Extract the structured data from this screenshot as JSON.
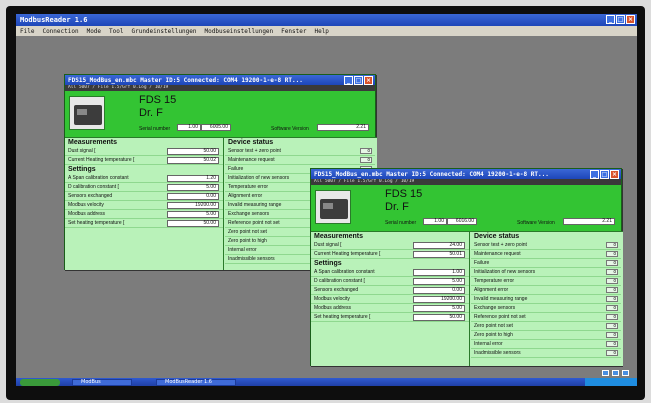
{
  "app": {
    "title": "ModbusReader 1.6",
    "menu": [
      "File",
      "Connection",
      "Mode",
      "Tool",
      "Grundeinstellungen",
      "Modbuseinstellungen",
      "Fenster",
      "Help"
    ]
  },
  "taskbar": {
    "start": "",
    "tasks": [
      "ModBus",
      "ModBusReader 1.6"
    ]
  },
  "windows": [
    {
      "title": "FDS15_ModBus_en.mbc Master ID:5 Connected: COM4 19200-1-e-8 RT...",
      "menu": "All 5007 / File 1.5/Grf 0.Log / 10/19",
      "product": "FDS 15",
      "owner": "Dr. F",
      "serial_label": "Serial number",
      "serial_a": "1.00",
      "serial_b": "6005.00",
      "sw_label": "Software Version",
      "sw_value": "2.21",
      "measurements": {
        "title": "Measurements",
        "rows": [
          {
            "label": "Dust signal [",
            "value": "50.00"
          },
          {
            "label": "Current Heating temperature [",
            "value": "50.02"
          }
        ]
      },
      "settings": {
        "title": "Settings",
        "rows": [
          {
            "label": "A Span calibration constant",
            "value": "1.20"
          },
          {
            "label": "D calibration constant [",
            "value": "5.00"
          },
          {
            "label": "Sensors exchanged",
            "value": "0.00"
          },
          {
            "label": "Modbus velocity",
            "value": "19200.00"
          },
          {
            "label": "Modbus address",
            "value": "5.00"
          },
          {
            "label": "Set heating temperature [",
            "value": "50.00"
          }
        ]
      },
      "status": {
        "title": "Device status",
        "rows": [
          {
            "label": "Sensor test + zero point",
            "value": "0"
          },
          {
            "label": "Maintenance request",
            "value": "0"
          },
          {
            "label": "Failure",
            "value": ""
          },
          {
            "label": "Initialization of new sensors",
            "value": ""
          },
          {
            "label": "Temperature error",
            "value": ""
          },
          {
            "label": "Alignment error",
            "value": ""
          },
          {
            "label": "Invalid measuring range",
            "value": ""
          },
          {
            "label": "Exchange sensors",
            "value": ""
          },
          {
            "label": "Reference point not set",
            "value": ""
          },
          {
            "label": "Zero point not set",
            "value": ""
          },
          {
            "label": "Zero point to high",
            "value": ""
          },
          {
            "label": "Internal error",
            "value": ""
          },
          {
            "label": "Inadmissible sensors",
            "value": ""
          }
        ]
      }
    },
    {
      "title": "FDS15_ModBus_en.mbc Master ID:5 Connected: COM4 19200-1-e-8 RT...",
      "menu": "All 5007 / File 1.5/Grf 0.Log / 10/19",
      "product": "FDS 15",
      "owner": "Dr. F",
      "serial_label": "Serial number",
      "serial_a": "1.00",
      "serial_b": "6016.00",
      "sw_label": "Software Version",
      "sw_value": "2.21",
      "measurements": {
        "title": "Measurements",
        "rows": [
          {
            "label": "Dust signal [",
            "value": "24.00"
          },
          {
            "label": "Current Heating temperature [",
            "value": "50.01"
          }
        ]
      },
      "settings": {
        "title": "Settings",
        "rows": [
          {
            "label": "A Span calibration constant",
            "value": "1.00"
          },
          {
            "label": "D calibration constant [",
            "value": "5.00"
          },
          {
            "label": "Sensors exchanged",
            "value": "0.00"
          },
          {
            "label": "Modbus velocity",
            "value": "19200.00"
          },
          {
            "label": "Modbus address",
            "value": "5.00"
          },
          {
            "label": "Set heating temperature [",
            "value": "50.00"
          }
        ]
      },
      "status": {
        "title": "Device status",
        "rows": [
          {
            "label": "Sensor test + zero point",
            "value": "0"
          },
          {
            "label": "Maintenance request",
            "value": "0"
          },
          {
            "label": "Failure",
            "value": "0"
          },
          {
            "label": "Initialization of new sensors",
            "value": "0"
          },
          {
            "label": "Temperature error",
            "value": "0"
          },
          {
            "label": "Alignment error",
            "value": "0"
          },
          {
            "label": "Invalid measuring range",
            "value": "0"
          },
          {
            "label": "Exchange sensors",
            "value": "0"
          },
          {
            "label": "Reference point not set",
            "value": "0"
          },
          {
            "label": "Zero point not set",
            "value": "0"
          },
          {
            "label": "Zero point to high",
            "value": "0"
          },
          {
            "label": "Internal error",
            "value": "0"
          },
          {
            "label": "Inadmissible sensors",
            "value": "0"
          }
        ]
      }
    }
  ]
}
